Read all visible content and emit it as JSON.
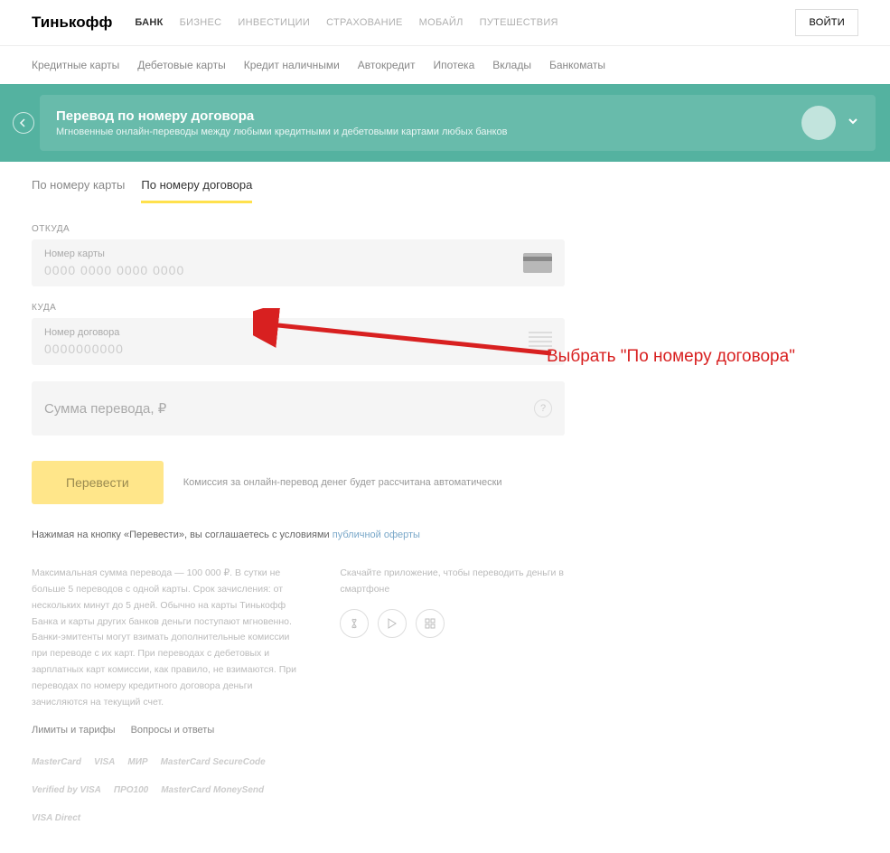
{
  "brand": "Тинькофф",
  "topnav": [
    "БАНК",
    "БИЗНЕС",
    "ИНВЕСТИЦИИ",
    "СТРАХОВАНИЕ",
    "МОБАЙЛ",
    "ПУТЕШЕСТВИЯ"
  ],
  "login": "ВОЙТИ",
  "subnav": [
    "Кредитные карты",
    "Дебетовые карты",
    "Кредит наличными",
    "Автокредит",
    "Ипотека",
    "Вклады",
    "Банкоматы"
  ],
  "hero": {
    "title": "Перевод по номеру договора",
    "sub": "Мгновенные онлайн-переводы между любыми кредитными и дебетовыми картами любых банков"
  },
  "tabs": {
    "card": "По номеру карты",
    "contract": "По номеру договора"
  },
  "annotation": "Выбрать \"По номеру договора\"",
  "from": {
    "section": "ОТКУДА",
    "label": "Номер карты",
    "placeholder": "0000 0000 0000 0000"
  },
  "to": {
    "section": "КУДА",
    "label": "Номер договора",
    "placeholder": "0000000000"
  },
  "amount": {
    "placeholder": "Сумма перевода, ₽"
  },
  "submit": "Перевести",
  "fee": "Комиссия за онлайн-перевод денег будет рассчитана автоматически",
  "agree_pre": "Нажимая на кнопку «Перевести», вы соглашаетесь с условиями ",
  "agree_link": "публичной оферты",
  "info_left": "Максимальная сумма перевода — 100 000 ₽. В сутки не больше 5 переводов с одной карты. Срок зачисления: от нескольких минут до 5 дней. Обычно на карты Тинькофф Банка и карты других банков деньги поступают мгновенно. Банки-эмитенты могут взимать дополнительные комиссии при переводе с их карт. При переводах с дебетовых и зарплатных карт комиссии, как правило, не взимаются. При переводах по номеру кредитного договора деньги зачисляются на текущий счет.",
  "info_right": "Скачайте приложение, чтобы переводить деньги в смартфоне",
  "links": {
    "limits": "Лимиты и тарифы",
    "faq": "Вопросы и ответы"
  },
  "paylogos": [
    "MasterCard",
    "VISA",
    "МИР",
    "MasterCard SecureCode",
    "Verified by VISA",
    "ПРО100",
    "MasterCard MoneySend",
    "VISA Direct"
  ]
}
